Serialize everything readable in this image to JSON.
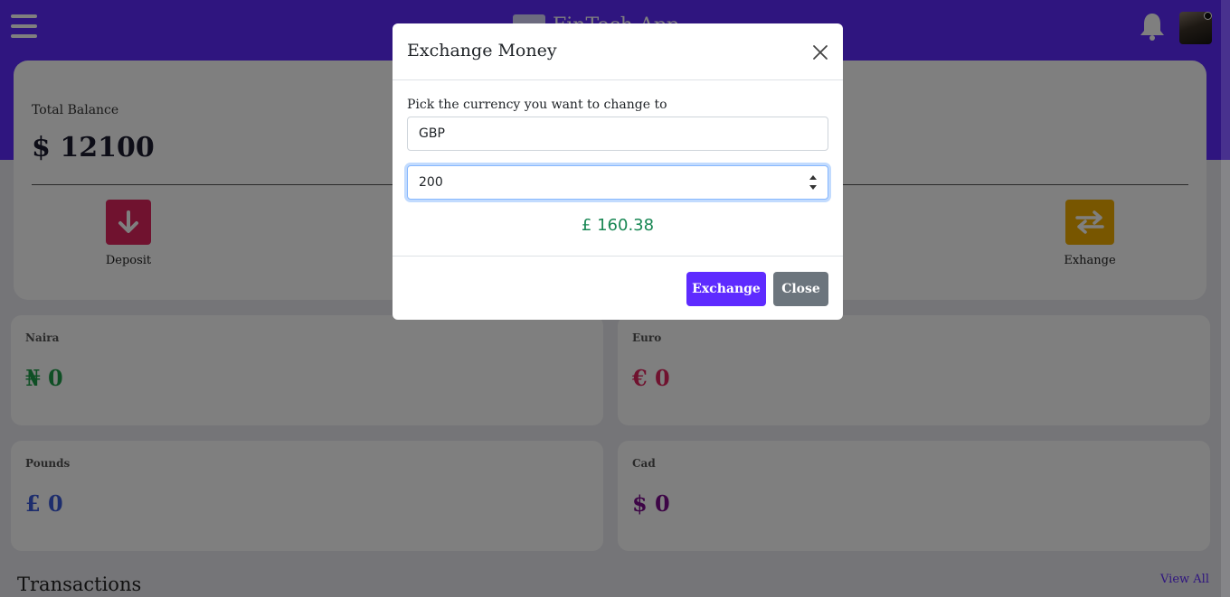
{
  "header": {
    "brand": "FinTech App"
  },
  "balance": {
    "label": "Total Balance",
    "value": "$ 12100"
  },
  "actions": [
    {
      "label": "Deposit",
      "icon": "arrow-down-icon",
      "color": "#e0245e"
    },
    {
      "label": "Exhange",
      "icon": "exchange-arrows-icon",
      "color": "#f0ad00"
    }
  ],
  "wallets": [
    {
      "name": "Naira",
      "amount": "₦ 0",
      "color": "#1e9e4a"
    },
    {
      "name": "Euro",
      "amount": "€ 0",
      "color": "#e0245e"
    },
    {
      "name": "Pounds",
      "amount": "£ 0",
      "color": "#3b5bdb"
    },
    {
      "name": "Cad",
      "amount": "$ 0",
      "color": "#7b0a8c"
    }
  ],
  "transactions": {
    "title": "Transactions",
    "view_all": "View All"
  },
  "modal": {
    "title": "Exchange Money",
    "field_label": "Pick the currency you want to change to",
    "currency_selected": "GBP",
    "amount_value": "200",
    "result": "£ 160.38",
    "exchange_button": "Exchange",
    "close_button": "Close"
  },
  "colors": {
    "primary": "#5e2bff",
    "success": "#198754",
    "secondary": "#6c757d"
  }
}
